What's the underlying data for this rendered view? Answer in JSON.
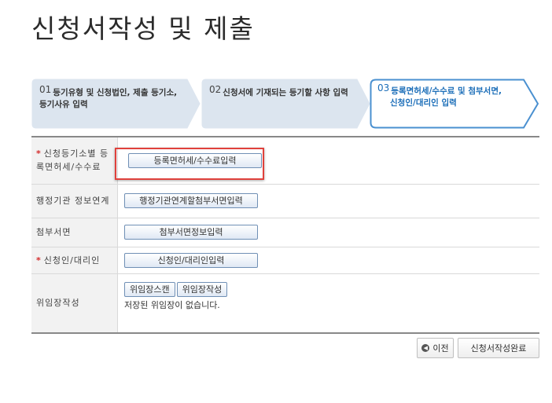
{
  "page": {
    "title": "신청서작성 및 제출"
  },
  "steps": [
    {
      "num": "01",
      "label_line1": "등기유형 및 신청법인, 제출 등기소,",
      "label_line2": "등기사유 입력",
      "active": false
    },
    {
      "num": "02",
      "label_line1": "신청서에 기재되는 등기할 사항 입력",
      "label_line2": "",
      "active": false
    },
    {
      "num": "03",
      "label_line1": "등록면허세/수수료 및 첨부서면,",
      "label_line2": "신청인/대리인 입력",
      "active": true
    }
  ],
  "form": {
    "rows": [
      {
        "required": "*",
        "label": "신청등기소별 등록면허세/수수료",
        "button": "등록면허세/수수료입력"
      },
      {
        "required": "",
        "label": "행정기관 정보연계",
        "button": "행정기관연계할첨부서면입력"
      },
      {
        "required": "",
        "label": "첨부서면",
        "button": "첨부서면정보입력"
      },
      {
        "required": "*",
        "label": "신청인/대리인",
        "button": "신청인/대리인입력"
      }
    ],
    "poa": {
      "label": "위임장작성",
      "scan_button": "위임장스캔",
      "write_button": "위임장작성",
      "status": "저장된 위임장이 없습니다."
    }
  },
  "actions": {
    "prev_label": "이전",
    "complete_label": "신청서작성완료"
  },
  "colors": {
    "active_step": "#1a6db8",
    "step_fill": "#dce5ef",
    "required": "#d42b2b",
    "highlight": "#e0413c"
  }
}
